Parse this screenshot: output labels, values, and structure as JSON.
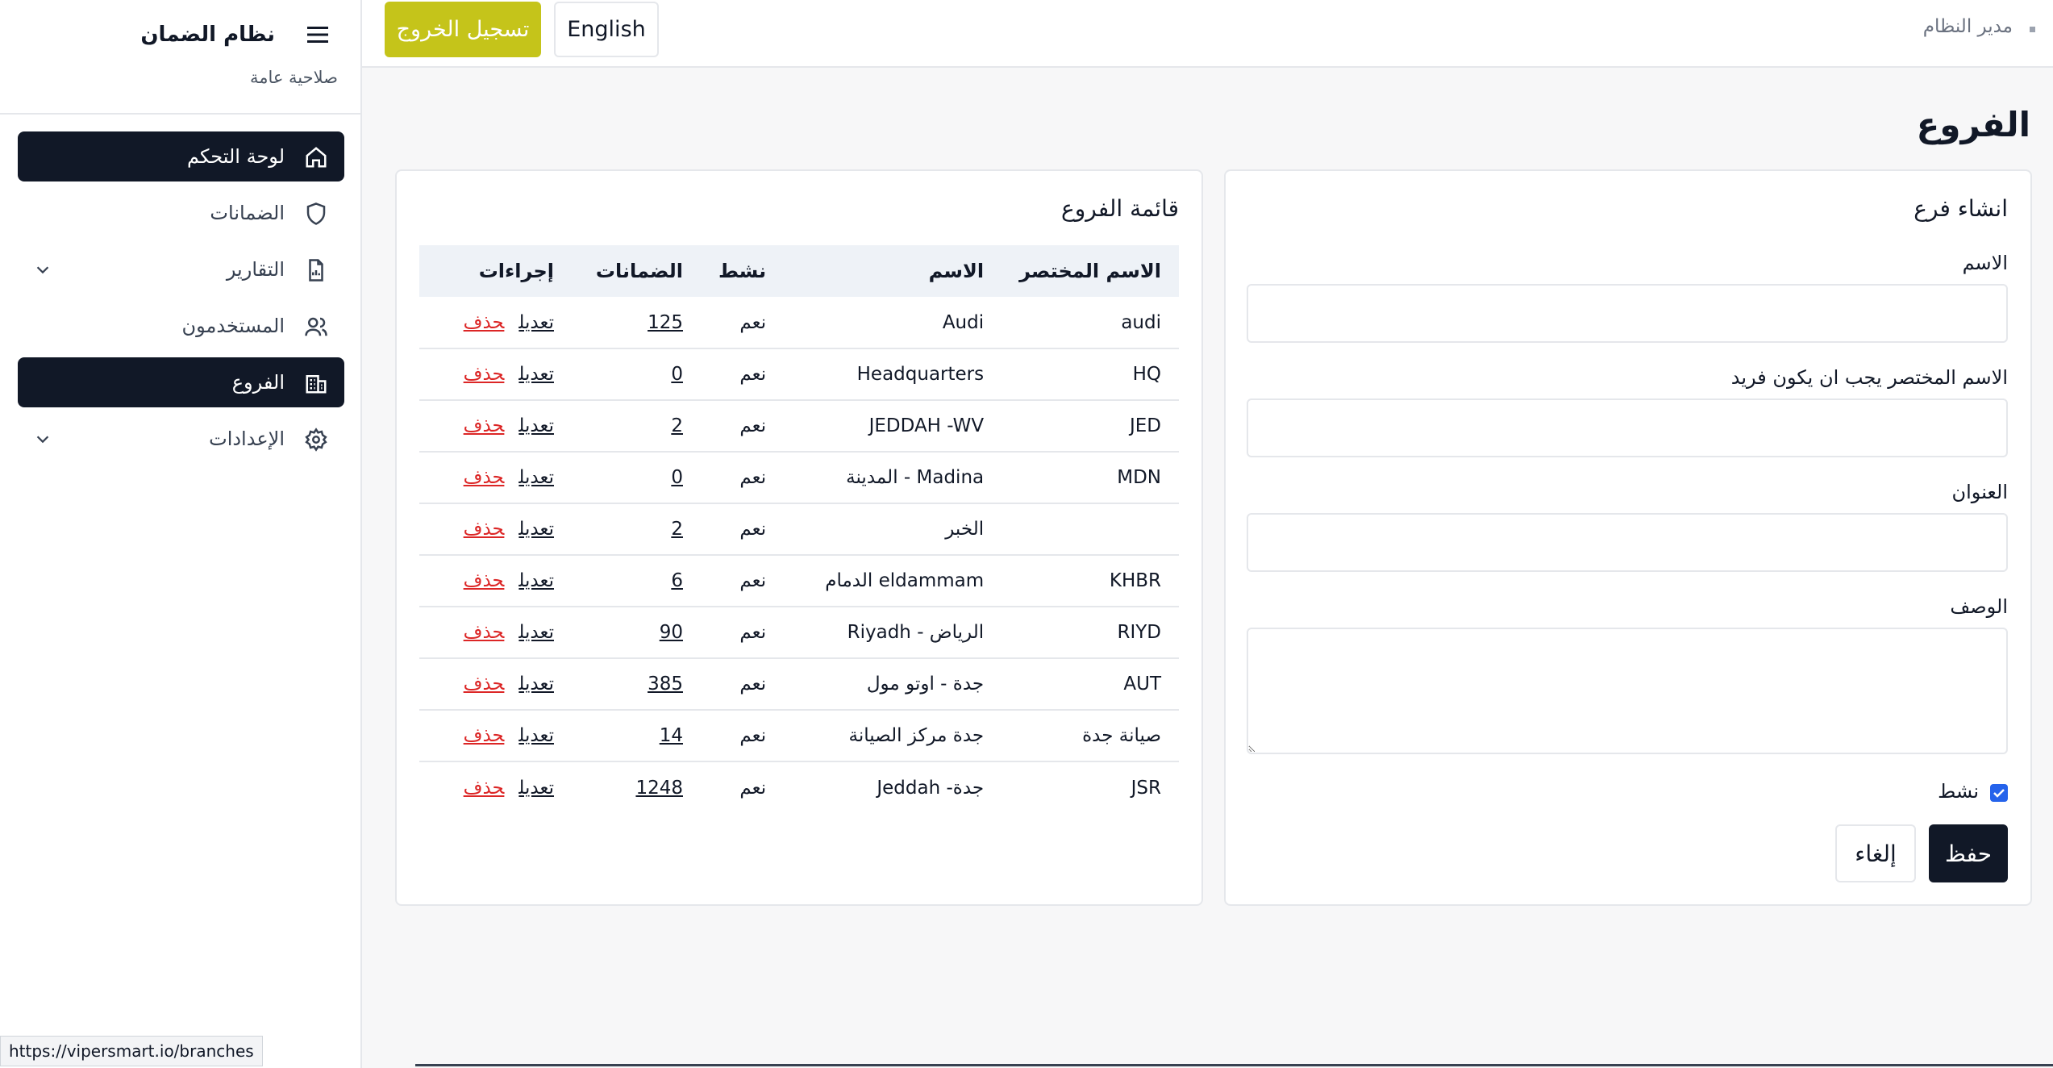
{
  "sidebar": {
    "title": "نظام الضمان",
    "subtitle": "صلاحية عامة",
    "items": [
      {
        "label": "لوحة التحكم",
        "icon": "home-icon",
        "active": true,
        "has_chevron": false
      },
      {
        "label": "الضمانات",
        "icon": "shield-icon",
        "active": false,
        "has_chevron": false
      },
      {
        "label": "التقارير",
        "icon": "report-icon",
        "active": false,
        "has_chevron": true
      },
      {
        "label": "المستخدمون",
        "icon": "users-icon",
        "active": false,
        "has_chevron": false
      },
      {
        "label": "الفروع",
        "icon": "building-icon",
        "active": true,
        "has_chevron": false
      },
      {
        "label": "الإعدادات",
        "icon": "gear-icon",
        "active": false,
        "has_chevron": true
      }
    ]
  },
  "topbar": {
    "logout_label": "تسجيل الخروج",
    "language_label": "English",
    "user_label": "مدير النظام"
  },
  "page": {
    "title": "الفروع"
  },
  "create_form": {
    "heading": "انشاء فرع",
    "name_label": "الاسم",
    "name_value": "",
    "short_label": "الاسم المختصر يجب ان يكون فريد",
    "short_value": "",
    "address_label": "العنوان",
    "address_value": "",
    "description_label": "الوصف",
    "description_value": "",
    "active_label": "نشط",
    "active_checked": true,
    "save_label": "حفظ",
    "cancel_label": "إلغاء"
  },
  "branch_list": {
    "heading": "قائمة الفروع",
    "columns": [
      "الاسم المختصر",
      "الاسم",
      "نشط",
      "الضمانات",
      "إجراءات"
    ],
    "edit_label": "تعديل",
    "delete_label": "حذف",
    "rows": [
      {
        "short": "audi",
        "name": "Audi",
        "active": "نعم",
        "count": "125"
      },
      {
        "short": "HQ",
        "name": "Headquarters",
        "active": "نعم",
        "count": "0"
      },
      {
        "short": "JED",
        "name": "JEDDAH -WV",
        "active": "نعم",
        "count": "2"
      },
      {
        "short": "MDN",
        "name": "Madina - المدينة",
        "active": "نعم",
        "count": "0"
      },
      {
        "short": "",
        "name": "الخبر",
        "active": "نعم",
        "count": "2"
      },
      {
        "short": "KHBR",
        "name": "eldammam الدمام",
        "active": "نعم",
        "count": "6"
      },
      {
        "short": "RIYD",
        "name": "الرياض - Riyadh",
        "active": "نعم",
        "count": "90"
      },
      {
        "short": "AUT",
        "name": "جدة - اوتو مول",
        "active": "نعم",
        "count": "385"
      },
      {
        "short": "صيانة جدة",
        "name": "جدة مركز الصيانة",
        "active": "نعم",
        "count": "14"
      },
      {
        "short": "JSR",
        "name": "جدة- Jeddah",
        "active": "نعم",
        "count": "1248"
      }
    ]
  },
  "status_bar": {
    "url": "https://vipersmart.io/branches"
  },
  "colors": {
    "accent_dark": "#111827",
    "logout": "#c5c41a",
    "delete": "#dc2626",
    "checkbox": "#2563eb"
  }
}
